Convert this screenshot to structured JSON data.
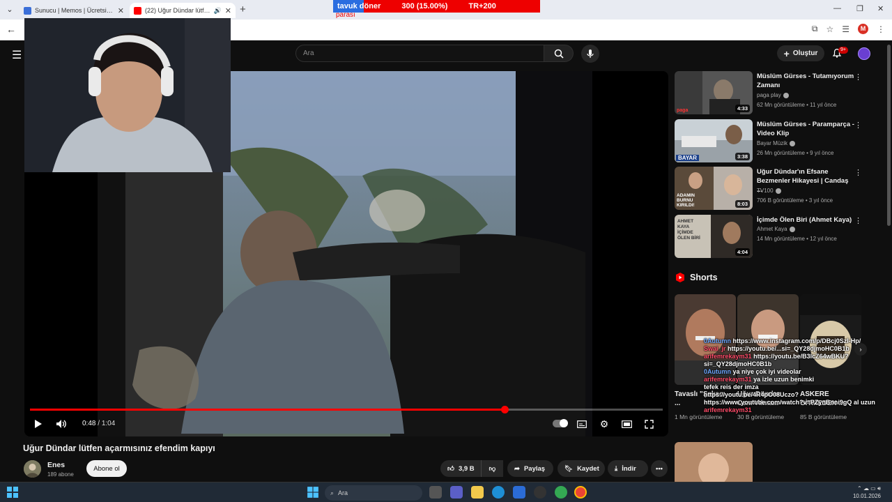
{
  "browser": {
    "tabs": [
      {
        "title": "Sunucu | Memos | Ücretsiz Min",
        "favicon_color": "#3b6fd8"
      },
      {
        "title": "(22) Uğur Dündar lütfen aç",
        "favicon_color": "#ff0000"
      }
    ],
    "ticker": {
      "item": "tavuk döner",
      "value": "300 (15.00%)",
      "amount": "TR+200",
      "sub": "parası"
    },
    "profile_initial": "M"
  },
  "youtube": {
    "search_placeholder": "Ara",
    "create_label": "Oluştur",
    "notification_count": "9+"
  },
  "player": {
    "current_time": "0:48",
    "duration": "1:04",
    "progress": 0.75
  },
  "video": {
    "title": "Uğur Dündar lütfen açarmısınız efendim kapıyı",
    "channel": "Enes",
    "subscribers": "189 abone",
    "subscribe_label": "Abone ol",
    "likes": "3,9 B",
    "share_label": "Paylaş",
    "save_label": "Kaydet",
    "download_label": "İndir"
  },
  "sidebar": {
    "recommendations": [
      {
        "title": "Müslüm Gürses - Tutamıyorum Zamanı",
        "channel": "paga play",
        "meta": "62 Mn görüntüleme • 11 yıl önce",
        "duration": "4:33",
        "thumb_label": "paga"
      },
      {
        "title": "Müslüm Gürses - Paramparça - Video Klip",
        "channel": "Bayar Müzik",
        "meta": "26 Mn görüntüleme • 9 yıl önce",
        "duration": "3:38",
        "thumb_label": "BAYAR"
      },
      {
        "title": "Uğur Dündar'ın Efsane Bezmenler Hikayesi | Candaş ...",
        "channel": "TV100",
        "meta": "706 B görüntüleme • 3 yıl önce",
        "duration": "8:03",
        "thumb_label": "ADAMIN BURNU KIRILDI!"
      },
      {
        "title": "İçimde Ölen Biri (Ahmet Kaya)",
        "channel": "Ahmet Kaya",
        "meta": "14 Mn görüntüleme • 12 yıl önce",
        "duration": "4:04",
        "thumb_label": "AHMET KAYA İÇİMDE ÖLEN BİRİ"
      }
    ],
    "shorts_header": "Shorts",
    "shorts": [
      {
        "title": "Tavaslı \"Şakacı ...",
        "meta": "1 Mn görüntüleme"
      },
      {
        "title": "Uğur Dündar Cem Yılma...",
        "meta": "30 B görüntüleme"
      },
      {
        "title": "ASKERE GİTMEDEN ...",
        "meta": "85 B görüntüleme"
      }
    ]
  },
  "chat": [
    {
      "user": "0Autumn",
      "text": "https://www.instagram.com/p/DBcj0SzI-Hp/"
    },
    {
      "user": "Swai_jr",
      "text": "https://youtu.be/...si=_QY28djmoHC0B1b"
    },
    {
      "user": "arifemrekaym31",
      "text": "https://youtu.be/B3lcZ64wBKU? si=_QY28djmoHC0B1b"
    },
    {
      "user": "0Autumn",
      "text": "ya niye çok iyi videolar"
    },
    {
      "user": "arifemrekaym31",
      "text": "ya izle uzun benimki"
    },
    {
      "user": "",
      "text": "tefek reis der imza"
    },
    {
      "user": "",
      "text": "https://youtu.be/4R4pO08Uczo?"
    },
    {
      "user": "",
      "text": "https://www.youtube.com/watch?v=PZynBnni9gQ al uzun"
    },
    {
      "user": "arifemrekaym31",
      "text": ""
    }
  ],
  "taskbar": {
    "search_label": "Ara",
    "date": "10.01.2026"
  }
}
